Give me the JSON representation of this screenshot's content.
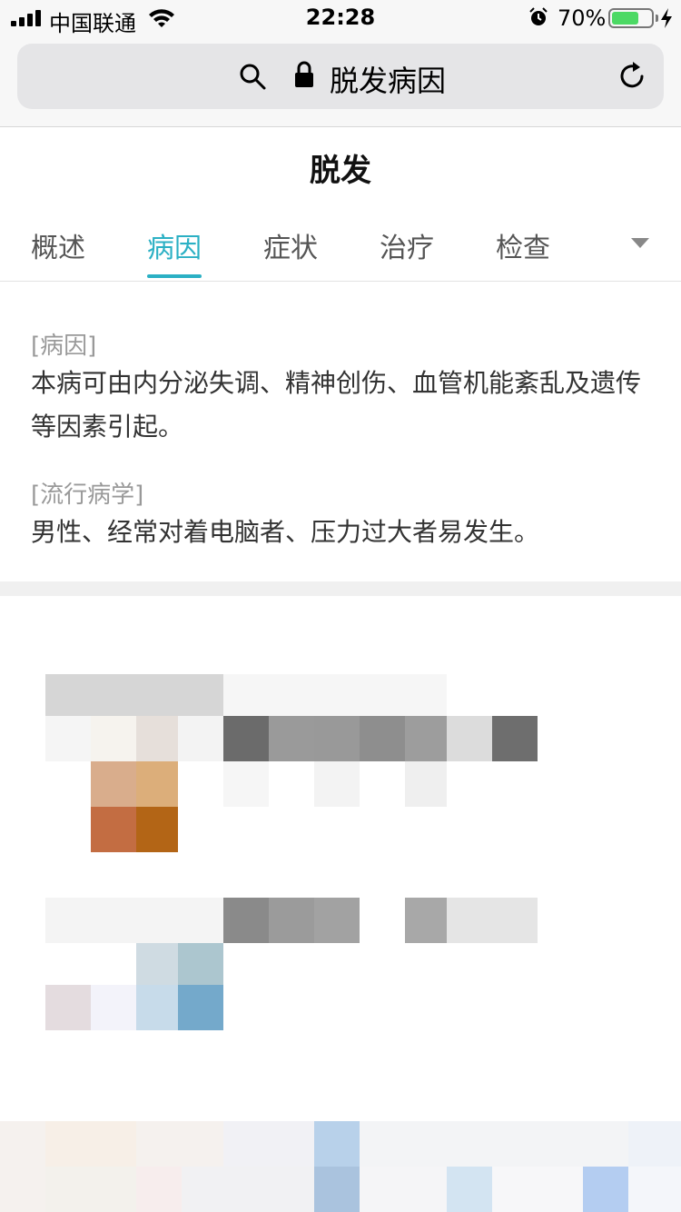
{
  "status": {
    "carrier": "中国联通",
    "time": "22:28",
    "battery_percent": "70%",
    "battery_level": 0.7
  },
  "browser": {
    "url_title": "脱发病因"
  },
  "page": {
    "title": "脱发"
  },
  "tabs": {
    "items": [
      "概述",
      "病因",
      "症状",
      "治疗",
      "检查"
    ],
    "active_index": 1
  },
  "content": {
    "cause_label": "[病因]",
    "cause_text": "本病可由内分泌失调、精神创伤、血管机能紊乱及遗传等因素引起。",
    "epidemiology_label": "[流行病学]",
    "epidemiology_text": "男性、经常对着电脑者、压力过大者易发生。"
  },
  "colors": {
    "accent": "#2bb0c4",
    "battery_green": "#4cd964"
  },
  "icons": [
    "signal-icon",
    "wifi-icon",
    "alarm-icon",
    "battery-icon",
    "charging-icon",
    "search-icon",
    "lock-icon",
    "reload-icon",
    "chevron-down-icon"
  ]
}
